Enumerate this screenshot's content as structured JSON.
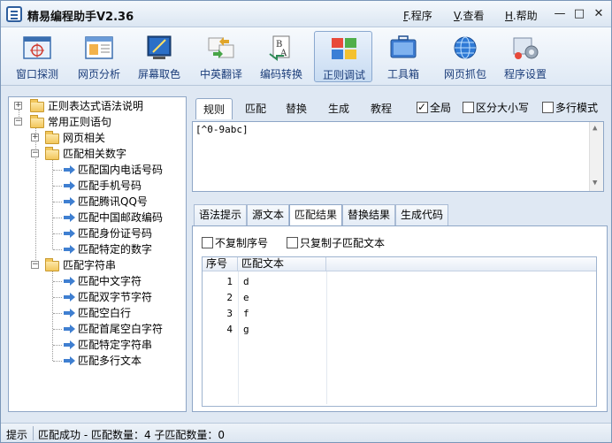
{
  "app": {
    "title": "精易编程助手V2.36"
  },
  "menu": {
    "items": [
      {
        "key": "F",
        "label": ".程序"
      },
      {
        "key": "V",
        "label": ".查看"
      },
      {
        "key": "H",
        "label": ".帮助"
      }
    ]
  },
  "window_controls": {
    "minimize": "—",
    "maximize": "□",
    "close": "✕"
  },
  "toolbar": {
    "items": [
      {
        "label": "窗口探测",
        "icon": "window-probe-icon"
      },
      {
        "label": "网页分析",
        "icon": "web-analyze-icon"
      },
      {
        "label": "屏幕取色",
        "icon": "color-picker-icon"
      },
      {
        "label": "中英翻译",
        "icon": "translate-icon"
      },
      {
        "label": "编码转换",
        "icon": "encoding-icon"
      },
      {
        "label": "正则调试",
        "icon": "regex-debug-icon",
        "active": true
      },
      {
        "label": "工具箱",
        "icon": "toolbox-icon"
      },
      {
        "label": "网页抓包",
        "icon": "packet-capture-icon"
      },
      {
        "label": "程序设置",
        "icon": "settings-icon"
      }
    ]
  },
  "tree": {
    "root1": "正则表达式语法说明",
    "root2": "常用正则语句",
    "group_web": "网页相关",
    "group_number": "匹配相关数字",
    "number_items": [
      "匹配国内电话号码",
      "匹配手机号码",
      "匹配腾讯QQ号",
      "匹配中国邮政编码",
      "匹配身份证号码",
      "匹配特定的数字"
    ],
    "group_string": "匹配字符串",
    "string_items": [
      "匹配中文字符",
      "匹配双字节字符",
      "匹配空白行",
      "匹配首尾空白字符",
      "匹配特定字符串",
      "匹配多行文本"
    ]
  },
  "regex_tabs": [
    "规则",
    "匹配",
    "替换",
    "生成",
    "教程"
  ],
  "options": {
    "global": "全局",
    "case": "区分大小写",
    "multiline": "多行模式",
    "global_checked": true
  },
  "regex": {
    "value": "[^0-9abc]"
  },
  "result_tabs": [
    "语法提示",
    "源文本",
    "匹配结果",
    "替换结果",
    "生成代码"
  ],
  "result": {
    "no_copy_index": "不复制序号",
    "copy_sub_only": "只复制子匹配文本",
    "columns": [
      "序号",
      "匹配文本"
    ],
    "rows": [
      [
        "1",
        "d"
      ],
      [
        "2",
        "e"
      ],
      [
        "3",
        "f"
      ],
      [
        "4",
        "g"
      ]
    ]
  },
  "status": {
    "hint": "提示",
    "message": "匹配成功 - 匹配数量：4  子匹配数量：0"
  }
}
